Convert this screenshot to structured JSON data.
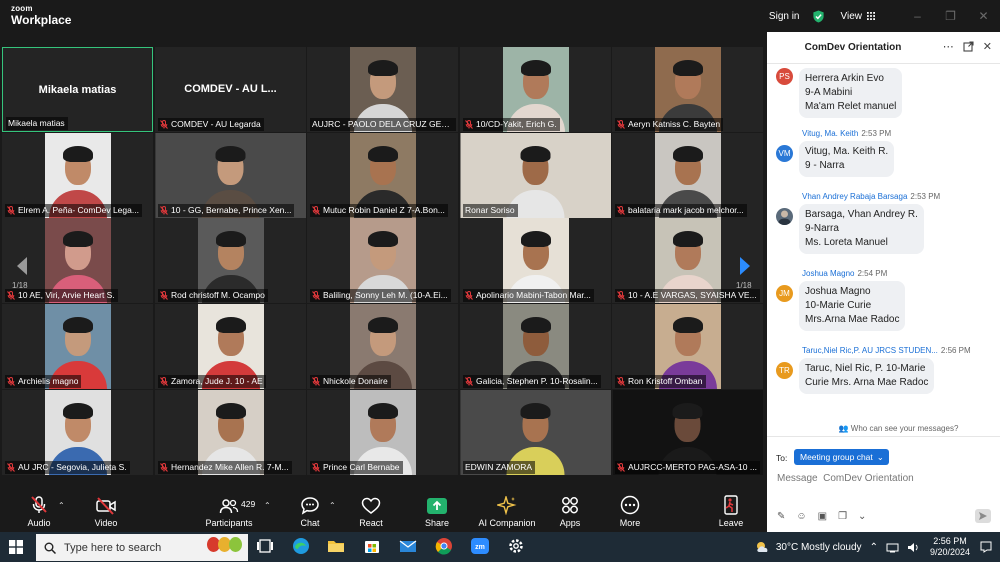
{
  "app": {
    "brand_top": "zoom",
    "brand_bottom": "Workplace"
  },
  "topbar": {
    "sign_in": "Sign in",
    "view": "View"
  },
  "tiles": [
    {
      "name": "Mikaela matias",
      "center_name": "Mikaela matias",
      "type": "avatar",
      "active": true,
      "muted": false
    },
    {
      "name": "COMDEV - AU Legarda",
      "center_name": "COMDEV - AU L...",
      "type": "avatar",
      "muted": true
    },
    {
      "name": "AUJRC - PAOLO DELA CRUZ GER...",
      "type": "video",
      "bg": "#6b5e52",
      "skin": "#c49a7c",
      "shirt": "#d6d6d6",
      "muted": false
    },
    {
      "name": "10/CD-Yakit, Erich G.",
      "type": "video",
      "bg": "#9db4a7",
      "skin": "#b07a5a",
      "shirt": "#e2d7cf",
      "muted": true
    },
    {
      "name": "Aeryn Katniss C. Bayten",
      "type": "video",
      "bg": "#8f6b4e",
      "skin": "#b07a5a",
      "shirt": "#3b3b3b",
      "muted": true
    },
    {
      "name": "Elrem A. Peña- ComDev Lega...",
      "type": "video",
      "bg": "#e9e9e9",
      "skin": "#c08a68",
      "shirt": "#c04848",
      "muted": true
    },
    {
      "name": "10 - GG, Bernabe, Prince Xen...",
      "type": "video",
      "wide": true,
      "bg": "#4a4a4a",
      "skin": "#c49a7c",
      "shirt": "#5a4d43",
      "muted": true
    },
    {
      "name": "Mutuc Robin Daniel Z 7-A.Bon...",
      "type": "video",
      "bg": "#8e7a63",
      "skin": "#a87350",
      "shirt": "#2a2a2a",
      "muted": true
    },
    {
      "name": "Ronar Soriso",
      "type": "video",
      "wide": true,
      "bg": "#d8d2c8",
      "skin": "#9e6a48",
      "shirt": "#e6e6e6",
      "muted": false
    },
    {
      "name": "balataria mark jacob melchor...",
      "type": "video",
      "bg": "#c9c6c1",
      "skin": "#a87350",
      "shirt": "#4a4a4a",
      "muted": true
    },
    {
      "name": "10 AE, Viri, Arvie Heart S.",
      "type": "video",
      "bg": "#7a4b4b",
      "skin": "#d19b8c",
      "shirt": "#d95f7a",
      "muted": true
    },
    {
      "name": "Rod christoff M. Ocampo",
      "type": "video",
      "bg": "#5a5a5a",
      "skin": "#b48360",
      "shirt": "#2b2b2b",
      "muted": true
    },
    {
      "name": "Baliling, Sonny Leh M. (10-A.Ei...",
      "type": "video",
      "bg": "#b69b8b",
      "skin": "#c49a7c",
      "shirt": "#d8d8d8",
      "muted": true
    },
    {
      "name": "Apolinario Mabini-Tabon Mar...",
      "type": "video",
      "bg": "#e6e0d6",
      "skin": "#a87350",
      "shirt": "#f0f0f0",
      "muted": true
    },
    {
      "name": "10 - A.E VARGAS, SYAISHA VE...",
      "type": "video",
      "bg": "#c7c3b7",
      "skin": "#b07a5a",
      "shirt": "#e8d4cc",
      "muted": true
    },
    {
      "name": "Archielis magno",
      "type": "video",
      "bg": "#6f8fa6",
      "skin": "#c49a7c",
      "shirt": "#d93a3a",
      "muted": true
    },
    {
      "name": "Zamora, Jude J. 10 - AE",
      "type": "video",
      "bg": "#e8e4dc",
      "skin": "#b07a5a",
      "shirt": "#d33b3b",
      "muted": true
    },
    {
      "name": "Nhickole Donaire",
      "type": "video",
      "bg": "#8a7a70",
      "skin": "#c49a7c",
      "shirt": "#5c4a42",
      "muted": true
    },
    {
      "name": "Galicia, Stephen P. 10-Rosalin...",
      "type": "video",
      "bg": "#8a8a80",
      "skin": "#8e5c3c",
      "shirt": "#2b2b2b",
      "muted": true
    },
    {
      "name": "Ron Kristoff Omban",
      "type": "video",
      "bg": "#c7ad90",
      "skin": "#b07a5a",
      "shirt": "#7a3b9a",
      "muted": true
    },
    {
      "name": "AU JRC - Segovia, Julieta S.",
      "type": "video",
      "bg": "#e0e0e0",
      "skin": "#c08a68",
      "shirt": "#3a6ab0",
      "muted": true
    },
    {
      "name": "Hernandez Mike Allen R. 7-M...",
      "type": "video",
      "bg": "#d6cfc6",
      "skin": "#a87350",
      "shirt": "#e6e6e6",
      "muted": true
    },
    {
      "name": "Prince Carl Bernabe",
      "type": "video",
      "bg": "#bdbdbd",
      "skin": "#b07a5a",
      "shirt": "#e8e8e8",
      "muted": true
    },
    {
      "name": "EDWIN ZAMORA",
      "type": "video",
      "wide": true,
      "bg": "#4a4a4a",
      "skin": "#a87350",
      "shirt": "#d9cf5a",
      "muted": false
    },
    {
      "name": "AUJRCC-MERTO PAG-ASA-10 ...",
      "type": "video",
      "wide": true,
      "bg": "#121212",
      "skin": "#6a4a3a",
      "shirt": "#1a1a1a",
      "muted": true
    }
  ],
  "pagination": {
    "left": "1/18",
    "right": "1/18"
  },
  "toolbar": {
    "audio": "Audio",
    "video": "Video",
    "participants": "Participants",
    "participants_count": "429",
    "chat": "Chat",
    "react": "React",
    "share": "Share",
    "ai": "AI Companion",
    "apps": "Apps",
    "more": "More",
    "leave": "Leave"
  },
  "chat": {
    "title": "ComDev Orientation",
    "messages": [
      {
        "initials": "PS",
        "color": "#d84b3c",
        "sender": "",
        "time": "",
        "lines": [
          "Herrera Arkin Evo",
          "9-A Mabini",
          "Ma'am Relet manuel"
        ]
      },
      {
        "initials": "VM",
        "color": "#2a78d6",
        "sender": "Vitug, Ma. Keith",
        "time": "2:53 PM",
        "lines": [
          "Vitug, Ma. Keith R.",
          "9 - Narra"
        ]
      },
      {
        "initials": "",
        "color": "#5a6a7a",
        "sender": "Vhan Andrey Rabaja Barsaga",
        "time": "2:53 PM",
        "lines": [
          "Barsaga, Vhan Andrey R.",
          "9-Narra",
          "Ms. Loreta Manuel"
        ]
      },
      {
        "initials": "JM",
        "color": "#e89a1e",
        "sender": "Joshua Magno",
        "time": "2:54 PM",
        "lines": [
          "Joshua Magno",
          "10-Marie Curie",
          "Mrs.Arna Mae Radoc"
        ]
      },
      {
        "initials": "TR",
        "color": "#e89a1e",
        "sender": "Taruc,Niel Ric,P. AU JRCS STUDEN...",
        "time": "2:56 PM",
        "lines": [
          "Taruc, Niel Ric, P. 10-Marie",
          "Curie Mrs. Arna Mae Radoc"
        ]
      }
    ],
    "who_can_see": "Who can see your messages?",
    "to_label": "To:",
    "to_value": "Meeting group chat",
    "message_placeholder": "Message  ComDev Orientation"
  },
  "taskbar": {
    "search_placeholder": "Type here to search",
    "weather": "30°C  Mostly cloudy",
    "time": "2:56 PM",
    "date": "9/20/2024"
  },
  "colors": {
    "zoom_blue": "#1a6fd6",
    "active_speaker": "#35c47c",
    "muted_red": "#e0383b",
    "share_green": "#23b26d"
  }
}
